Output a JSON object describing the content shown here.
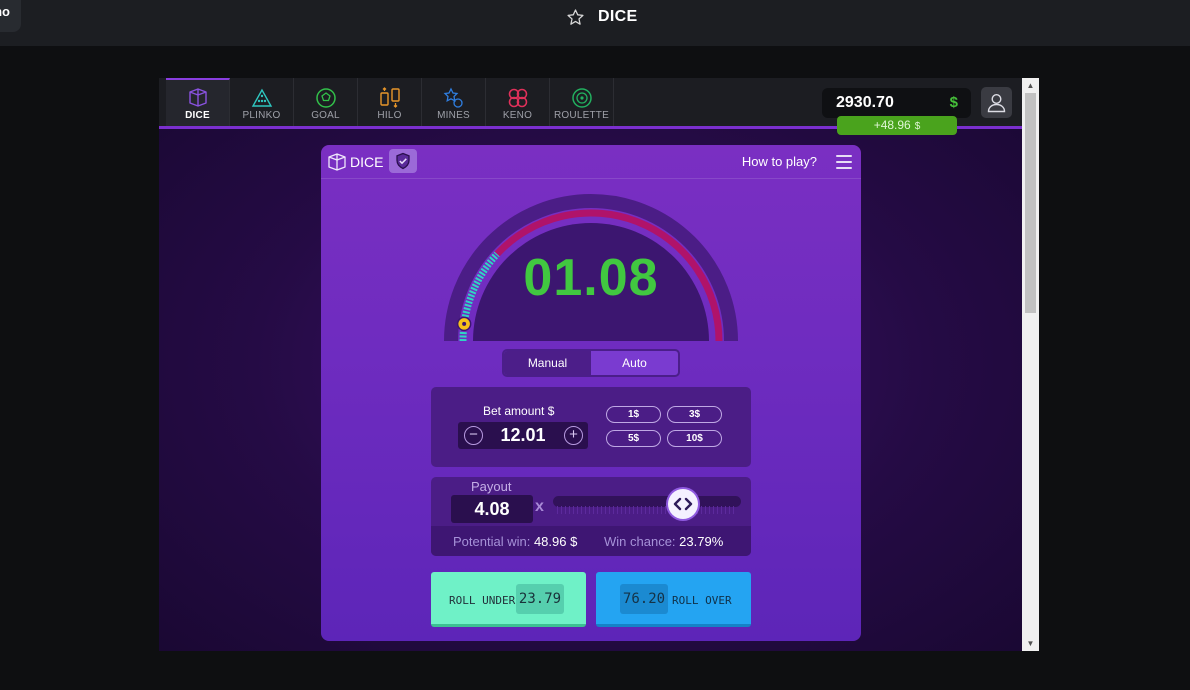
{
  "app": {
    "corner_text": "no",
    "title": "DICE"
  },
  "nav": {
    "tabs": [
      {
        "label": "DICE",
        "icon": "dice-icon",
        "color": "#8a52e0",
        "active": true
      },
      {
        "label": "PLINKO",
        "icon": "plinko-icon",
        "color": "#2ec7c0"
      },
      {
        "label": "GOAL",
        "icon": "goal-icon",
        "color": "#32c04a"
      },
      {
        "label": "HILO",
        "icon": "hilo-icon",
        "color": "#e8962a"
      },
      {
        "label": "MINES",
        "icon": "mines-icon",
        "color": "#2f7ee0"
      },
      {
        "label": "KENO",
        "icon": "keno-icon",
        "color": "#e0305a"
      },
      {
        "label": "ROULETTE",
        "icon": "roulette-icon",
        "color": "#22b060"
      }
    ],
    "balance": "2930.70",
    "balance_currency": "$",
    "last_win": "+48.96",
    "last_win_currency": "$"
  },
  "game": {
    "name": "DICE",
    "how_to_play": "How to play?",
    "result": "01.08",
    "gauge": {
      "max": 100,
      "roll_under_threshold": 23.79,
      "result_value": 1.08,
      "win_color": "#2fd5c4",
      "lose_color": "#b0136a"
    },
    "modes": [
      "Manual",
      "Auto"
    ],
    "active_mode": "Manual",
    "bet_label": "Bet amount $",
    "bet_value": "12.01",
    "quick_bets": [
      "1$",
      "3$",
      "5$",
      "10$"
    ],
    "payout_label": "Payout",
    "payout_value": "4.08",
    "payout_suffix": "x",
    "slider_fraction": 0.69,
    "potential_win_label": "Potential win:",
    "potential_win_value": "48.96 $",
    "win_chance_label": "Win chance:",
    "win_chance_value": "23.79%",
    "roll_under_label": "ROLL UNDER",
    "roll_under_value": "23.79",
    "roll_over_label": "ROLL OVER",
    "roll_over_value": "76.20"
  }
}
